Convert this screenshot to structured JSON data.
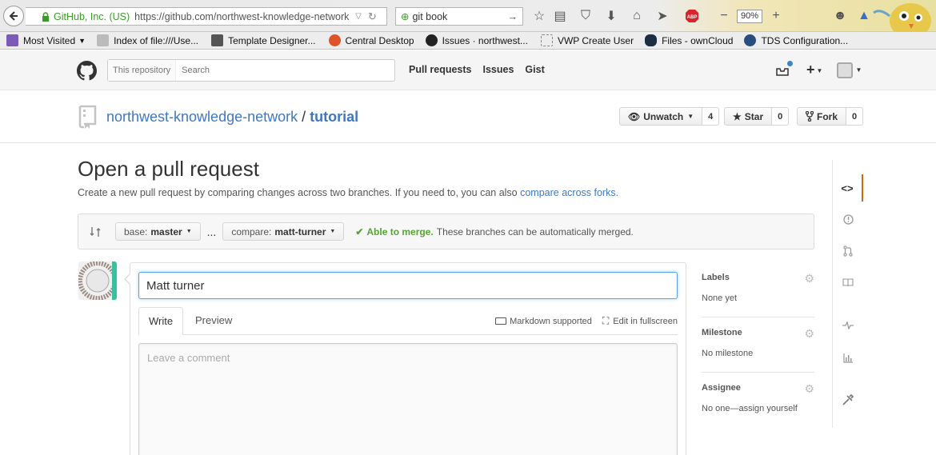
{
  "browser": {
    "identity": "GitHub, Inc. (US)",
    "url_prefix": "https://github.com/",
    "url_rest": "northwest-knowledge-network",
    "search_value": "git book",
    "zoom": "90%",
    "bookmarks": [
      "Most Visited",
      "Index of file:///Use...",
      "Template Designer...",
      "Central Desktop",
      "Issues · northwest...",
      "VWP Create User",
      "Files - ownCloud",
      "TDS Configuration..."
    ]
  },
  "header": {
    "scope_label": "This repository",
    "search_placeholder": "Search",
    "nav": [
      "Pull requests",
      "Issues",
      "Gist"
    ]
  },
  "repo": {
    "owner": "northwest-knowledge-network",
    "separator": "/",
    "name": "tutorial",
    "unwatch_label": "Unwatch",
    "watch_count": "4",
    "star_label": "Star",
    "star_count": "0",
    "fork_label": "Fork",
    "fork_count": "0"
  },
  "page": {
    "title": "Open a pull request",
    "description": "Create a new pull request by comparing changes across two branches. If you need to, you can also",
    "description_link": "compare across forks."
  },
  "range": {
    "base_label": "base:",
    "base_branch": "master",
    "dots": "...",
    "compare_label": "compare:",
    "compare_branch": "matt-turner",
    "merge_status": "Able to merge.",
    "merge_note": "These branches can be automatically merged."
  },
  "composer": {
    "title_value": "Matt turner",
    "tab_write": "Write",
    "tab_preview": "Preview",
    "markdown_label": "Markdown supported",
    "fullscreen_label": "Edit in fullscreen",
    "comment_placeholder": "Leave a comment"
  },
  "sidebar": {
    "sections": [
      {
        "heading": "Labels",
        "value": "None yet"
      },
      {
        "heading": "Milestone",
        "value": "No milestone"
      },
      {
        "heading": "Assignee",
        "value": "No one—assign yourself"
      }
    ]
  },
  "colors": {
    "link": "#4078c0",
    "success": "#55a532",
    "focus": "#51a7e8",
    "nav_selected": "#d26911"
  }
}
